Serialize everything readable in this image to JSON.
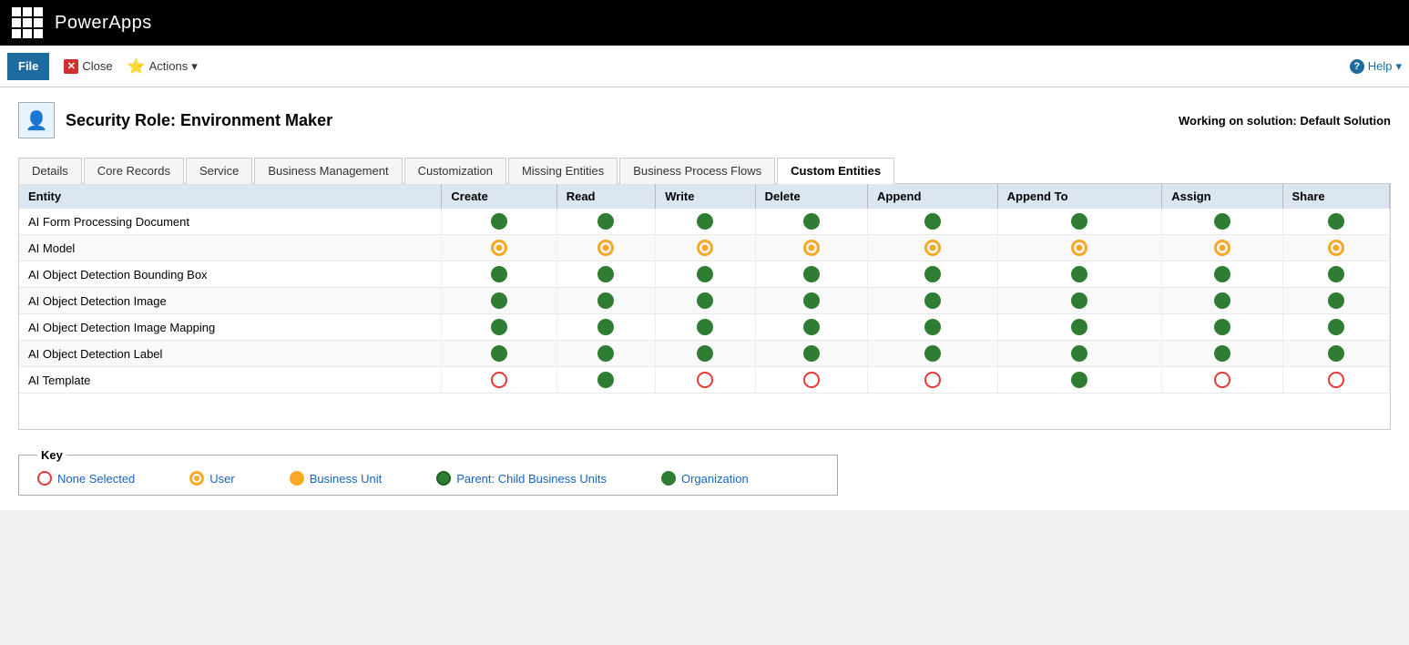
{
  "topbar": {
    "app_title": "PowerApps"
  },
  "toolbar": {
    "file_label": "File",
    "close_label": "Close",
    "actions_label": "Actions",
    "help_label": "Help"
  },
  "page": {
    "title": "Security Role: Environment Maker",
    "solution_info": "Working on solution: Default Solution"
  },
  "tabs": [
    {
      "id": "details",
      "label": "Details"
    },
    {
      "id": "core-records",
      "label": "Core Records"
    },
    {
      "id": "service",
      "label": "Service"
    },
    {
      "id": "business-management",
      "label": "Business Management"
    },
    {
      "id": "customization",
      "label": "Customization"
    },
    {
      "id": "missing-entities",
      "label": "Missing Entities"
    },
    {
      "id": "business-process-flows",
      "label": "Business Process Flows"
    },
    {
      "id": "custom-entities",
      "label": "Custom Entities"
    }
  ],
  "table": {
    "columns": [
      "Entity",
      "Create",
      "Read",
      "Write",
      "Delete",
      "Append",
      "Append To",
      "Assign",
      "Share"
    ],
    "rows": [
      {
        "entity": "AI Form Processing Document",
        "permissions": [
          "green",
          "green",
          "green",
          "green",
          "green",
          "green",
          "green",
          "green"
        ]
      },
      {
        "entity": "AI Model",
        "permissions": [
          "yellow-outline",
          "yellow-outline",
          "yellow-outline",
          "yellow-outline",
          "yellow-outline",
          "yellow-outline",
          "yellow-outline",
          "yellow-outline"
        ]
      },
      {
        "entity": "AI Object Detection Bounding Box",
        "permissions": [
          "green",
          "green",
          "green",
          "green",
          "green",
          "green",
          "green",
          "green"
        ]
      },
      {
        "entity": "AI Object Detection Image",
        "permissions": [
          "green",
          "green",
          "green",
          "green",
          "green",
          "green",
          "green",
          "green"
        ]
      },
      {
        "entity": "AI Object Detection Image Mapping",
        "permissions": [
          "green",
          "green",
          "green",
          "green",
          "green",
          "green",
          "green",
          "green"
        ]
      },
      {
        "entity": "AI Object Detection Label",
        "permissions": [
          "green",
          "green",
          "green",
          "green",
          "green",
          "green",
          "green",
          "green"
        ]
      },
      {
        "entity": "AI Template",
        "permissions": [
          "red-outline",
          "green",
          "red-outline",
          "red-outline",
          "red-outline",
          "green",
          "red-outline",
          "red-outline"
        ]
      }
    ]
  },
  "key": {
    "title": "Key",
    "items": [
      {
        "type": "none",
        "label": "None Selected"
      },
      {
        "type": "user",
        "label": "User"
      },
      {
        "type": "business-unit",
        "label": "Business Unit"
      },
      {
        "type": "parent-child",
        "label": "Parent: Child Business Units"
      },
      {
        "type": "organization",
        "label": "Organization"
      }
    ]
  }
}
